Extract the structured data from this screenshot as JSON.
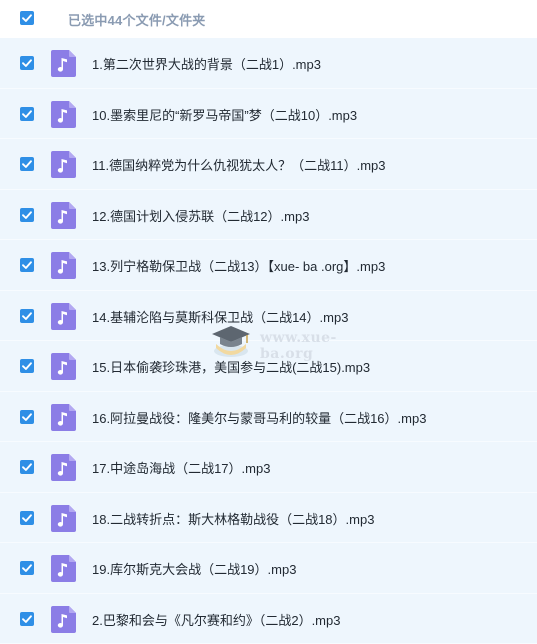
{
  "header": {
    "selection_text": "已选中44个文件/文件夹",
    "all_checked": true
  },
  "files": [
    {
      "name": "1.第二次世界大战的背景（二战1）.mp3",
      "checked": true,
      "icon": "music-file-icon"
    },
    {
      "name": "10.墨索里尼的“新罗马帝国”梦（二战10）.mp3",
      "checked": true,
      "icon": "music-file-icon"
    },
    {
      "name": "11.德国纳粹党为什么仇视犹太人？（二战11）.mp3",
      "checked": true,
      "icon": "music-file-icon"
    },
    {
      "name": "12.德国计划入侵苏联（二战12）.mp3",
      "checked": true,
      "icon": "music-file-icon"
    },
    {
      "name": "13.列宁格勒保卫战（二战13）【xue- ba .org】.mp3",
      "checked": true,
      "icon": "music-file-icon"
    },
    {
      "name": "14.基辅沦陷与莫斯科保卫战（二战14）.mp3",
      "checked": true,
      "icon": "music-file-icon"
    },
    {
      "name": "15.日本偷袭珍珠港，美国参与二战(二战15).mp3",
      "checked": true,
      "icon": "music-file-icon"
    },
    {
      "name": "16.阿拉曼战役：隆美尔与蒙哥马利的较量（二战16）.mp3",
      "checked": true,
      "icon": "music-file-icon"
    },
    {
      "name": "17.中途岛海战（二战17）.mp3",
      "checked": true,
      "icon": "music-file-icon"
    },
    {
      "name": "18.二战转折点：斯大林格勒战役（二战18）.mp3",
      "checked": true,
      "icon": "music-file-icon"
    },
    {
      "name": "19.库尔斯克大会战（二战19）.mp3",
      "checked": true,
      "icon": "music-file-icon"
    },
    {
      "name": "2.巴黎和会与《凡尔赛和约》（二战2）.mp3",
      "checked": true,
      "icon": "music-file-icon"
    }
  ],
  "watermark": {
    "text": "www.xue-ba.org"
  },
  "colors": {
    "checkbox": "#2f8fe6",
    "row_background": "#eef6fd",
    "file_icon": "#8b7de6",
    "header_text": "#8a9bb2"
  }
}
